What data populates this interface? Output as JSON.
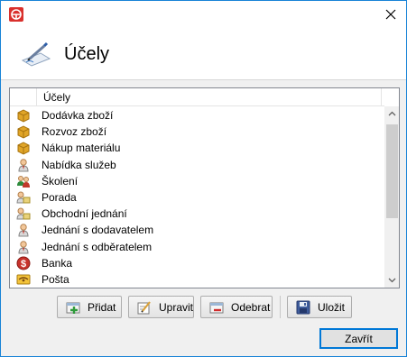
{
  "window": {
    "title_icon": "app-logo-icon",
    "close_icon": "close-icon"
  },
  "header": {
    "title": "Účely",
    "icon": "pen-paper-icon"
  },
  "list": {
    "column_header": "Účely",
    "items": [
      {
        "label": "Dodávka zboží",
        "icon": "box-icon"
      },
      {
        "label": "Rozvoz zboží",
        "icon": "box-icon"
      },
      {
        "label": "Nákup materiálu",
        "icon": "box-icon"
      },
      {
        "label": "Nabídka služeb",
        "icon": "person-icon"
      },
      {
        "label": "Školení",
        "icon": "group-icon"
      },
      {
        "label": "Porada",
        "icon": "meeting-icon"
      },
      {
        "label": "Obchodní jednání",
        "icon": "meeting-icon"
      },
      {
        "label": "Jednání s dodavatelem",
        "icon": "person-icon"
      },
      {
        "label": "Jednání s odběratelem",
        "icon": "person-icon"
      },
      {
        "label": "Banka",
        "icon": "bank-icon"
      },
      {
        "label": "Pošta",
        "icon": "post-icon"
      }
    ]
  },
  "toolbar": {
    "add_label": "Přidat",
    "edit_label": "Upravit",
    "remove_label": "Odebrat",
    "save_label": "Uložit"
  },
  "footer": {
    "close_label": "Zavřít"
  }
}
